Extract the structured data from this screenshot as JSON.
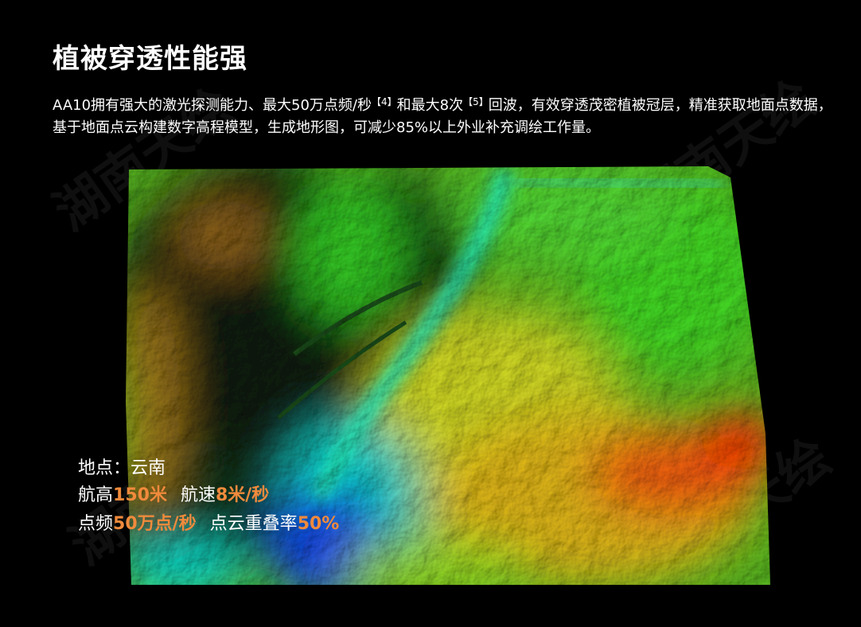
{
  "header": {
    "title": "植被穿透性能强"
  },
  "description": {
    "part1": "AA10拥有强大的激光探测能力、最大50万点频/秒",
    "ref1": "【4】",
    "part2": "和最大8次",
    "ref2": "【5】",
    "part3": "回波，有效穿透茂密植被冠层，精准获取地面点数据，基于地面点云构建数字高程模型，生成地形图，可减少85%以上外业补充调绘工作量。"
  },
  "watermark": {
    "text": "湖南天绘"
  },
  "info": {
    "location_label": "地点：",
    "location_value": "云南",
    "altitude_label": "航高",
    "altitude_value": "150米",
    "speed_label": "航速",
    "speed_value": "8米/秒",
    "frequency_label": "点频",
    "frequency_value": "50万点/秒",
    "overlap_label": "点云重叠率",
    "overlap_value": "50%"
  },
  "colors": {
    "background": "#000000",
    "highlight": "#f08a3c"
  }
}
